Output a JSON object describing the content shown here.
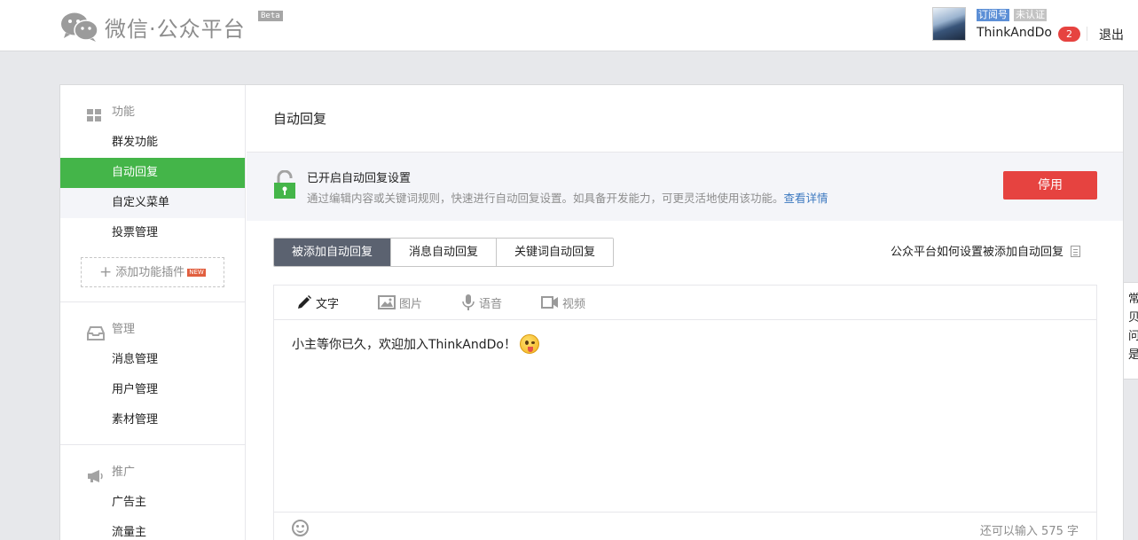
{
  "header": {
    "logo_text": "微信·公众平台",
    "beta_label": "Beta",
    "account_type_tag": "订阅号",
    "verification_tag": "未认证",
    "username": "ThinkAndDo",
    "notification_count": "2",
    "logout_label": "退出"
  },
  "sidebar": {
    "groups": [
      {
        "title": "功能",
        "icon": "grid-icon",
        "items": [
          "群发功能",
          "自动回复",
          "自定义菜单",
          "投票管理"
        ],
        "add_plugin_label": "添加功能插件",
        "new_tag": "NEW"
      },
      {
        "title": "管理",
        "icon": "inbox-icon",
        "items": [
          "消息管理",
          "用户管理",
          "素材管理"
        ]
      },
      {
        "title": "推广",
        "icon": "megaphone-icon",
        "items": [
          "广告主",
          "流量主"
        ]
      }
    ],
    "active_item": "自动回复"
  },
  "main": {
    "page_title": "自动回复",
    "status": {
      "title": "已开启自动回复设置",
      "description": "通过编辑内容或关键词规则，快速进行自动回复设置。如具备开发能力，可更灵活地使用该功能。",
      "details_link": "查看详情",
      "disable_button": "停用"
    },
    "tabs": [
      "被添加自动回复",
      "消息自动回复",
      "关键词自动回复"
    ],
    "active_tab": 0,
    "help_link": "公众平台如何设置被添加自动回复",
    "editor": {
      "tools": [
        "文字",
        "图片",
        "语音",
        "视频"
      ],
      "active_tool": 0,
      "message_text": "小主等你已久，欢迎加入ThinkAndDo！",
      "remaining_label": "还可以输入 575 字"
    }
  },
  "side_popup": {
    "text": "常贝问是"
  },
  "colors": {
    "accent_green": "#44b549",
    "danger_red": "#e64340",
    "tab_active": "#5b6270",
    "link_blue": "#3c79c0"
  }
}
